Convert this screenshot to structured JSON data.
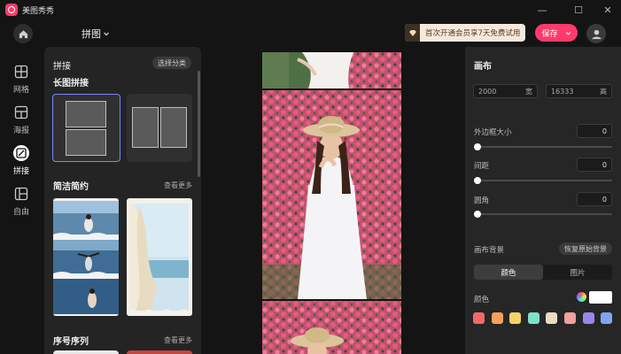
{
  "app": {
    "name": "美图秀秀"
  },
  "window": {
    "minimize": "—",
    "maximize": "☐",
    "close": "✕"
  },
  "toolbar": {
    "mode_title": "拼图",
    "vip_promo": "首次开通会员享7天免费试用",
    "save_label": "保存"
  },
  "leftnav": {
    "items": [
      {
        "label": "网格",
        "icon": "grid-icon",
        "active": false
      },
      {
        "label": "海报",
        "icon": "poster-icon",
        "active": false
      },
      {
        "label": "拼接",
        "icon": "stitch-icon",
        "active": true
      },
      {
        "label": "自由",
        "icon": "free-layout-icon",
        "active": false
      }
    ]
  },
  "panel": {
    "title": "拼接",
    "filter_label": "选择分类",
    "sections": [
      {
        "title": "长图拼接",
        "more": ""
      },
      {
        "title": "简洁简约",
        "more": "查看更多"
      },
      {
        "title": "序号序列",
        "more": "查看更多"
      }
    ]
  },
  "canvas_settings": {
    "title": "画布",
    "width": "2000",
    "width_label": "宽",
    "height": "16333",
    "height_label": "高",
    "border_label": "外边框大小",
    "border_value": "0",
    "spacing_label": "间距",
    "spacing_value": "0",
    "radius_label": "圆角",
    "radius_value": "0",
    "bg_label": "画布背景",
    "restore_label": "恢复原始背景",
    "tab_color": "颜色",
    "tab_image": "图片",
    "color_label": "颜色",
    "swatches": [
      "#f06a6a",
      "#f3a15a",
      "#f1d468",
      "#7ee0c9",
      "#e9dcc0",
      "#f0a0a0",
      "#9b86e8",
      "#7ea6f0"
    ]
  }
}
